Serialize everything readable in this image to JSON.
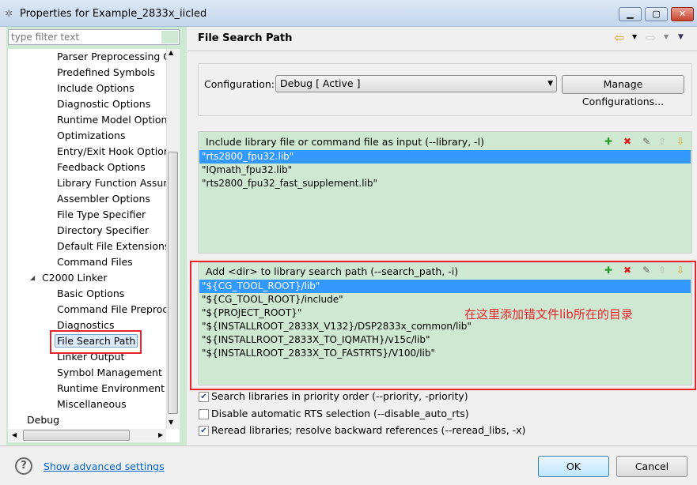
{
  "window": {
    "title": "Properties for Example_2833x_iicled",
    "minimize": "▁",
    "maximize": "▢",
    "close": "✕"
  },
  "filter": {
    "placeholder": "type filter text"
  },
  "tree": {
    "items": [
      {
        "label": "Parser Preprocessing O",
        "level": 2
      },
      {
        "label": "Predefined Symbols",
        "level": 2
      },
      {
        "label": "Include Options",
        "level": 2
      },
      {
        "label": "Diagnostic Options",
        "level": 2
      },
      {
        "label": "Runtime Model Options",
        "level": 2
      },
      {
        "label": "Optimizations",
        "level": 2
      },
      {
        "label": "Entry/Exit Hook Options",
        "level": 2
      },
      {
        "label": "Feedback Options",
        "level": 2
      },
      {
        "label": "Library Function Assump",
        "level": 2
      },
      {
        "label": "Assembler Options",
        "level": 2
      },
      {
        "label": "File Type Specifier",
        "level": 2
      },
      {
        "label": "Directory Specifier",
        "level": 2
      },
      {
        "label": "Default File Extensions",
        "level": 2
      },
      {
        "label": "Command Files",
        "level": 2
      },
      {
        "label": "C2000 Linker",
        "level": 1,
        "expanded": true
      },
      {
        "label": "Basic Options",
        "level": 2
      },
      {
        "label": "Command File Preproce",
        "level": 2
      },
      {
        "label": "Diagnostics",
        "level": 2
      },
      {
        "label": "File Search Path",
        "level": 2,
        "selected": true
      },
      {
        "label": "Linker Output",
        "level": 2
      },
      {
        "label": "Symbol Management",
        "level": 2
      },
      {
        "label": "Runtime Environment",
        "level": 2
      },
      {
        "label": "Miscellaneous",
        "level": 2
      },
      {
        "label": "Debug",
        "level": 0
      }
    ]
  },
  "page": {
    "title": "File Search Path"
  },
  "config": {
    "label": "Configuration:",
    "value": "Debug  [ Active ]",
    "manage": "Manage Configurations..."
  },
  "libraries": {
    "header": "Include library file or command file as input (--library, -l)",
    "items": [
      "\"rts2800_fpu32.lib\"",
      "\"IQmath_fpu32.lib\"",
      "\"rts2800_fpu32_fast_supplement.lib\""
    ]
  },
  "search_paths": {
    "header": "Add <dir> to library search path (--search_path, -i)",
    "items": [
      "\"${CG_TOOL_ROOT}/lib\"",
      "\"${CG_TOOL_ROOT}/include\"",
      "\"${PROJECT_ROOT}\"",
      "\"${INSTALLROOT_2833X_V132}/DSP2833x_common/lib\"",
      "\"${INSTALLROOT_2833X_TO_IQMATH}/v15c/lib\"",
      "\"${INSTALLROOT_2833X_TO_FASTRTS}/V100/lib\""
    ]
  },
  "annotation": "在这里添加错文件lib所在的目录",
  "options": [
    {
      "label": "Search libraries in priority order (--priority, -priority)",
      "checked": true
    },
    {
      "label": "Disable automatic RTS selection (--disable_auto_rts)",
      "checked": false
    },
    {
      "label": "Reread libraries; resolve backward references (--reread_libs, -x)",
      "checked": true
    }
  ],
  "footer": {
    "help": "?",
    "advanced": "Show advanced settings",
    "ok": "OK",
    "cancel": "Cancel"
  },
  "colors": {
    "selection": "#3399ff",
    "list_bg": "#cfe8d2",
    "highlight": "#e8232b"
  }
}
